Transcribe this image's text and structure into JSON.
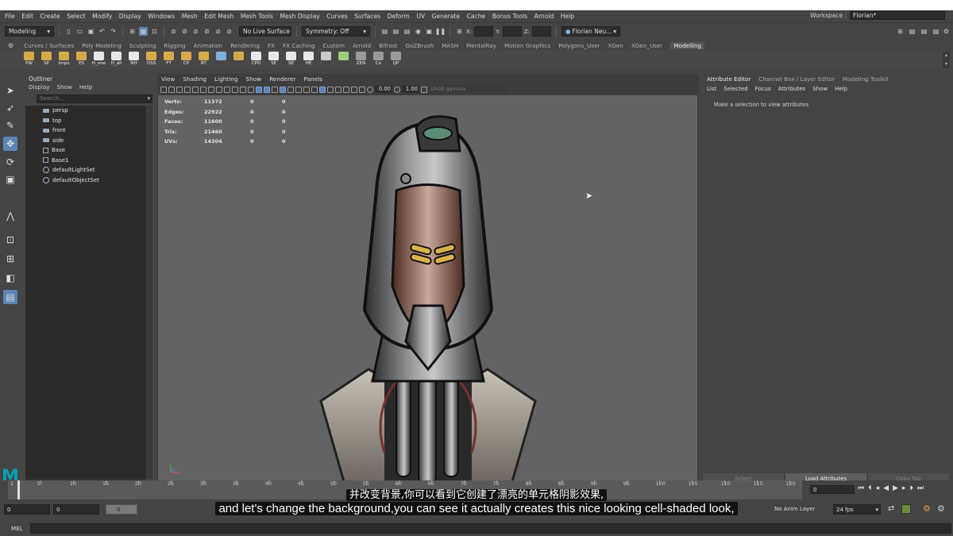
{
  "menubar": {
    "items": [
      "File",
      "Edit",
      "Create",
      "Select",
      "Modify",
      "Display",
      "Windows",
      "Mesh",
      "Edit Mesh",
      "Mesh Tools",
      "Mesh Display",
      "Curves",
      "Surfaces",
      "Deform",
      "UV",
      "Generate",
      "Cache",
      "Bonus Tools",
      "Arnold",
      "Help"
    ],
    "workspace_label": "Workspace :",
    "workspace_value": "Florian*"
  },
  "toolbar": {
    "mode": "Modeling",
    "live_surface": "No Live Surface",
    "symmetry": "Symmetry: Off",
    "x_label": "X:",
    "y_label": "Y:",
    "z_label": "Z:",
    "user": "Florian Neu..."
  },
  "shelf": {
    "tabs": [
      "Curves / Surfaces",
      "Poly Modeling",
      "Sculpting",
      "Rigging",
      "Animation",
      "Rendering",
      "FX",
      "FX Caching",
      "Custom",
      "Arnold",
      "Bifrost",
      "GoZBrush",
      "MASH",
      "MentalRay",
      "Motion Graphics",
      "Polygons_User",
      "XGen",
      "XGen_User",
      "Modelling"
    ],
    "active_tab": "Modelling",
    "buttons": [
      {
        "label": "PW",
        "color": "#d9a84a"
      },
      {
        "label": "SP",
        "color": "#d9a84a"
      },
      {
        "label": "Impo",
        "color": "#d9a84a"
      },
      {
        "label": "ES",
        "color": "#d9a84a"
      },
      {
        "label": "H_one",
        "color": "#e8e8e8"
      },
      {
        "label": "H_all",
        "color": "#e8e8e8"
      },
      {
        "label": "NH",
        "color": "#e8e8e8"
      },
      {
        "label": "OSS",
        "color": "#d9a84a"
      },
      {
        "label": "FT",
        "color": "#d9a84a"
      },
      {
        "label": "CP",
        "color": "#d9a84a"
      },
      {
        "label": "RT",
        "color": "#d9a84a"
      },
      {
        "label": "",
        "color": "#7fb2d9"
      },
      {
        "label": "",
        "color": "#d9a84a"
      },
      {
        "label": "CPD",
        "color": "#e8e8e8"
      },
      {
        "label": "SE",
        "color": "#e8e8e8"
      },
      {
        "label": "SE",
        "color": "#e8e8e8"
      },
      {
        "label": "HE",
        "color": "#e8e8e8"
      },
      {
        "label": "",
        "color": "#c9c9c9"
      },
      {
        "label": "",
        "color": "#9ad07a"
      },
      {
        "label": "ZEN",
        "color": "#9a9a9a"
      },
      {
        "label": "Co",
        "color": "#9a9a9a"
      },
      {
        "label": "QP",
        "color": "#9a9a9a"
      }
    ]
  },
  "outliner": {
    "title": "Outliner",
    "menu": [
      "Display",
      "Show",
      "Help"
    ],
    "search_placeholder": "Search...",
    "items": [
      {
        "name": "persp",
        "kind": "camera"
      },
      {
        "name": "top",
        "kind": "camera"
      },
      {
        "name": "front",
        "kind": "camera"
      },
      {
        "name": "side",
        "kind": "camera"
      },
      {
        "name": "Base",
        "kind": "group"
      },
      {
        "name": "Base1",
        "kind": "group"
      },
      {
        "name": "defaultLightSet",
        "kind": "set"
      },
      {
        "name": "defaultObjectSet",
        "kind": "set"
      }
    ]
  },
  "viewport": {
    "menu": [
      "View",
      "Shading",
      "Lighting",
      "Show",
      "Renderer",
      "Panels"
    ],
    "exposure": "0.00",
    "gamma": "1.00",
    "colorspace": "sRGB gamma",
    "hud": [
      {
        "label": "Verts:",
        "a": "11372",
        "b": "0",
        "c": "0"
      },
      {
        "label": "Edges:",
        "a": "22922",
        "b": "0",
        "c": "0"
      },
      {
        "label": "Faces:",
        "a": "11600",
        "b": "0",
        "c": "0"
      },
      {
        "label": "Tris:",
        "a": "21460",
        "b": "0",
        "c": "0"
      },
      {
        "label": "UVs:",
        "a": "14304",
        "b": "0",
        "c": "0"
      }
    ]
  },
  "attribute_editor": {
    "tabs": [
      "Attribute Editor",
      "Channel Box / Layer Editor",
      "Modeling Toolkit"
    ],
    "menu": [
      "List",
      "Selected",
      "Focus",
      "Attributes",
      "Show",
      "Help"
    ],
    "message": "Make a selection to view attributes",
    "buttons": [
      "Select",
      "Load Attributes",
      "Copy Tab"
    ]
  },
  "timeline": {
    "ticks": [
      "5",
      "10",
      "15",
      "20",
      "25",
      "30",
      "35",
      "40",
      "45",
      "50",
      "55",
      "60",
      "65",
      "70",
      "75",
      "80",
      "85",
      "90",
      "95",
      "100",
      "105",
      "110",
      "115",
      "120"
    ],
    "current_frame": "0",
    "first_tick": "1"
  },
  "range": {
    "start": "0",
    "start2": "0",
    "slider": "0",
    "anim_layer": "No Anim Layer",
    "fps": "24 fps"
  },
  "command_line": {
    "label": "MEL"
  },
  "subtitles": {
    "zh": "并改变背景,你可以看到它创建了漂亮的单元格阴影效果,",
    "en": "and let's change the background,you can see it actually creates this nice looking cell-shaded look,"
  }
}
